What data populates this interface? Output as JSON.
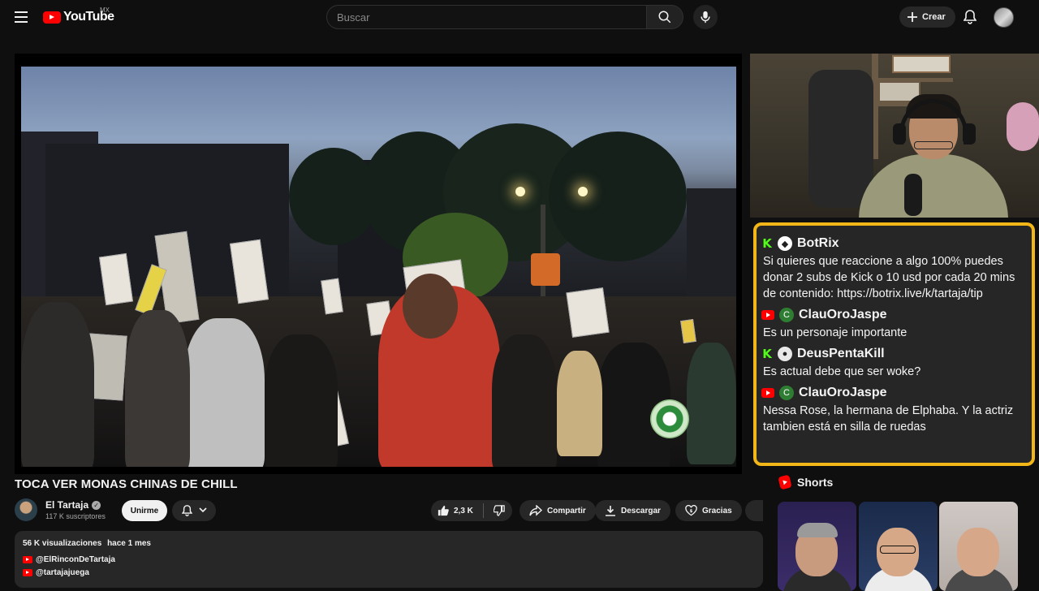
{
  "header": {
    "logo_text": "YouTube",
    "country_code": "MX",
    "search_placeholder": "Buscar",
    "create_label": "Crear"
  },
  "video": {
    "title": "TOCA VER MONAS CHINAS DE CHILL"
  },
  "channel": {
    "name": "El Tartaja",
    "subscribers": "117 K suscriptores",
    "join_label": "Unirme"
  },
  "actions": {
    "like_count": "2,3 K",
    "share_label": "Compartir",
    "download_label": "Descargar",
    "thanks_label": "Gracias"
  },
  "description": {
    "views": "56 K visualizaciones",
    "age": "hace 1 mes",
    "links": [
      "@ElRinconDeTartaja",
      "@tartajajuega"
    ]
  },
  "chat_overlay": {
    "accent_color": "#f2b619",
    "messages": [
      {
        "platform": "kick",
        "badge": "bot",
        "user": "BotRix",
        "text": "Si quieres que reaccione a algo 100% puedes donar 2 subs de Kick o 10 usd por cada 20 mins de contenido: https://botrix.live/k/tartaja/tip"
      },
      {
        "platform": "youtube",
        "badge": "C",
        "user": "ClauOroJaspe",
        "text": "Es un personaje importante"
      },
      {
        "platform": "kick",
        "badge": "avatar",
        "user": "DeusPentaKill",
        "text": "Es actual debe que ser woke?"
      },
      {
        "platform": "youtube",
        "badge": "C",
        "user": "ClauOroJaspe",
        "text": "Nessa Rose, la hermana de Elphaba. Y la actriz tambien está en silla de ruedas"
      }
    ]
  },
  "shorts": {
    "label": "Shorts"
  }
}
